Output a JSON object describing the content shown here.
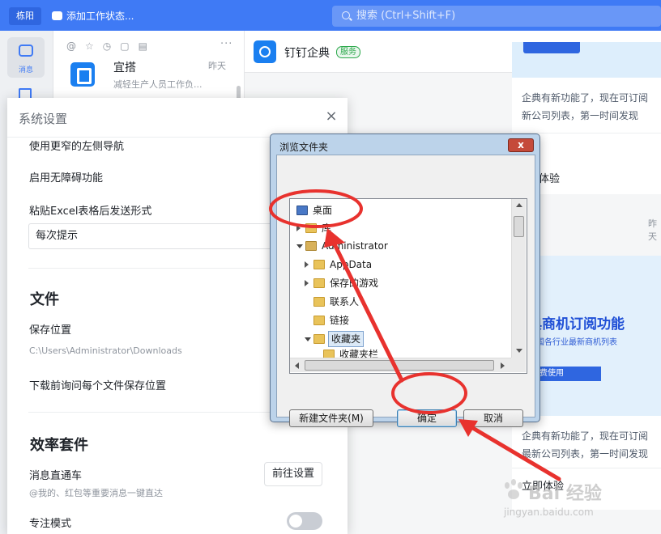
{
  "topbar": {
    "avatar_text": "栋阳",
    "status_text": "添加工作状态...",
    "search_placeholder": "搜索 (Ctrl+Shift+F)"
  },
  "rail": {
    "messages_label": "消息"
  },
  "conversation_list": {
    "tools": [
      "@",
      "☆",
      "◷",
      "▢",
      "▤"
    ],
    "more": "···",
    "item": {
      "name": "宜搭",
      "time": "昨天",
      "preview": "减轻生产人员工作负..."
    }
  },
  "chat": {
    "title": "钉钉企典",
    "tag": "服务",
    "card1": {
      "line1": "企典有新功能了，现在可订阅",
      "line2": "新公司列表，第一时间发现",
      "link": "即体验"
    },
    "time2": "昨天",
    "card2": {
      "title": "典商机订阅功能",
      "subtitle": "全国各行业最新商机列表",
      "button": "费使用",
      "line1": "企典有新功能了，现在可订阅",
      "line2": "最新公司列表，第一时间发现",
      "link": "立即体验"
    }
  },
  "settings": {
    "title": "系统设置",
    "close": "×",
    "narrow_nav": "使用更窄的左侧导航",
    "accessibility": "启用无障碍功能",
    "excel_paste": "粘贴Excel表格后发送形式",
    "excel_option": "每次提示",
    "files_section": "文件",
    "save_location": "保存位置",
    "save_path": "C:\\Users\\Administrator\\Downloads",
    "ask_location": "下载前询问每个文件保存位置",
    "efficiency_section": "效率套件",
    "message_express": "消息直通车",
    "message_express_desc": "@我的、红包等重要消息一键直达",
    "go_settings": "前往设置",
    "focus_mode": "专注模式",
    "focus_mode_on": false
  },
  "browse_dialog": {
    "title": "浏览文件夹",
    "close": "x",
    "tree": [
      {
        "label": "桌面",
        "icon": "desktop-icon"
      },
      {
        "label": "库",
        "icon": "library-icon"
      },
      {
        "label": "Administrator",
        "icon": "user-folder-icon"
      },
      {
        "label": "AppData",
        "icon": "folder-icon"
      },
      {
        "label": "保存的游戏",
        "icon": "folder-icon"
      },
      {
        "label": "联系人",
        "icon": "folder-icon"
      },
      {
        "label": "链接",
        "icon": "folder-icon"
      },
      {
        "label": "收藏夹",
        "icon": "folder-icon"
      },
      {
        "label": "收藏夹栏",
        "icon": "folder-icon"
      }
    ],
    "new_folder_button": "新建文件夹(M)",
    "ok_button": "确定",
    "cancel_button": "取消"
  },
  "annotation": {
    "color": "#e8322e"
  },
  "watermark": {
    "text": "Bai 经验",
    "url": "jingyan.baidu.com"
  }
}
